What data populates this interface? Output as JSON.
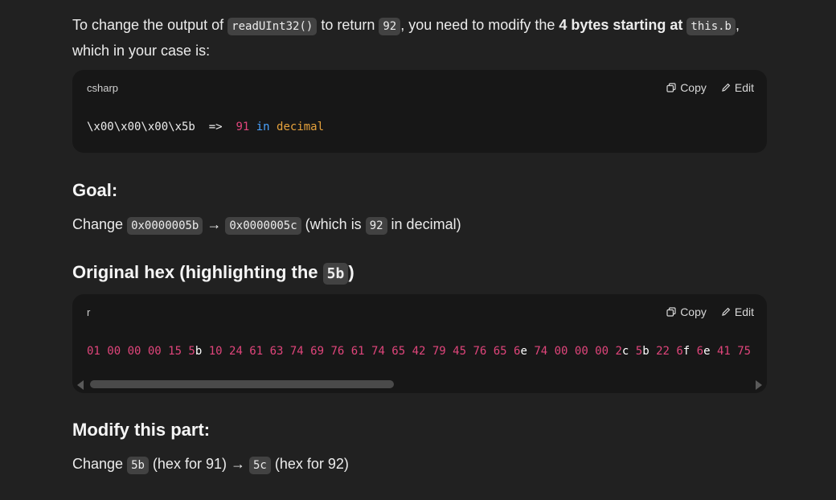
{
  "intro": {
    "t1": "To change the output of ",
    "c1": "readUInt32()",
    "t2": " to return ",
    "c2": "92",
    "t3": ", you need to modify the ",
    "bold": "4 bytes starting at",
    "t4": " ",
    "c3": "this.b",
    "t5": ",",
    "line2": "which in your case is:"
  },
  "block1": {
    "lang": "csharp",
    "copy_label": "Copy",
    "edit_label": "Edit",
    "code_plain": "\\x00\\x00\\x00\\x5b  =>  ",
    "code_num": "91",
    "code_kw": "in",
    "code_word": "decimal"
  },
  "goal": {
    "heading": "Goal:",
    "t1": "Change ",
    "c1": "0x0000005b",
    "t2": " → ",
    "c2": "0x0000005c",
    "t3": " (which is ",
    "c3": "92",
    "t4": " in decimal)"
  },
  "orig": {
    "heading_text": "Original hex (highlighting the ",
    "heading_code": "5b",
    "heading_close": ")"
  },
  "block2": {
    "lang": "r",
    "copy_label": "Copy",
    "edit_label": "Edit",
    "segments": [
      {
        "t": "01 00 00 00 15 5",
        "c": "pink"
      },
      {
        "t": "b",
        "c": "white"
      },
      {
        "t": " 10 24 61 63 74 69 76 61 74 65 42 79 45 76 65 6",
        "c": "pink"
      },
      {
        "t": "e",
        "c": "white"
      },
      {
        "t": " 74 00 00 00 2",
        "c": "pink"
      },
      {
        "t": "c",
        "c": "white"
      },
      {
        "t": " 5",
        "c": "pink"
      },
      {
        "t": "b",
        "c": "white"
      },
      {
        "t": " 22 6",
        "c": "pink"
      },
      {
        "t": "f",
        "c": "white"
      },
      {
        "t": " 6",
        "c": "pink"
      },
      {
        "t": "e",
        "c": "white"
      },
      {
        "t": " 41 75",
        "c": "pink"
      }
    ]
  },
  "modify": {
    "heading": "Modify this part:",
    "t1": "Change ",
    "c1": "5b",
    "t2": " (hex for 91) → ",
    "c2": "5c",
    "t3": " (hex for 92)"
  }
}
